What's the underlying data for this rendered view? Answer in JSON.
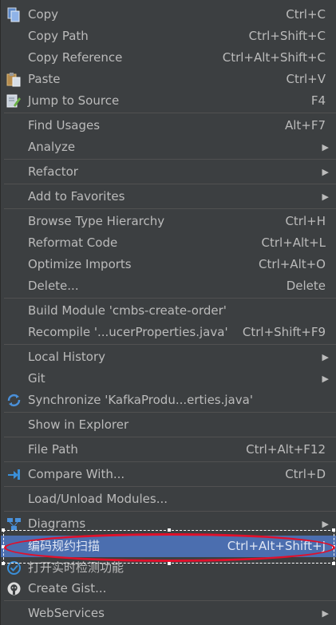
{
  "items": [
    {
      "label": "Copy",
      "shortcut": "Ctrl+C",
      "icon": "copy-icon"
    },
    {
      "label": "Copy Path",
      "shortcut": "Ctrl+Shift+C"
    },
    {
      "label": "Copy Reference",
      "shortcut": "Ctrl+Alt+Shift+C"
    },
    {
      "label": "Paste",
      "shortcut": "Ctrl+V",
      "icon": "paste-icon"
    },
    {
      "label": "Jump to Source",
      "shortcut": "F4",
      "icon": "edit-source-icon"
    },
    {
      "label": "Find Usages",
      "shortcut": "Alt+F7"
    },
    {
      "label": "Analyze",
      "submenu": true
    },
    {
      "label": "Refactor",
      "submenu": true
    },
    {
      "label": "Add to Favorites",
      "submenu": true
    },
    {
      "label": "Browse Type Hierarchy",
      "shortcut": "Ctrl+H"
    },
    {
      "label": "Reformat Code",
      "shortcut": "Ctrl+Alt+L"
    },
    {
      "label": "Optimize Imports",
      "shortcut": "Ctrl+Alt+O"
    },
    {
      "label": "Delete...",
      "shortcut": "Delete"
    },
    {
      "label": "Build Module 'cmbs-create-order'"
    },
    {
      "label": "Recompile '...ucerProperties.java'",
      "shortcut": "Ctrl+Shift+F9"
    },
    {
      "label": "Local History",
      "submenu": true
    },
    {
      "label": "Git",
      "submenu": true
    },
    {
      "label": "Synchronize 'KafkaProdu...erties.java'",
      "icon": "sync-icon"
    },
    {
      "label": "Show in Explorer"
    },
    {
      "label": "File Path",
      "shortcut": "Ctrl+Alt+F12"
    },
    {
      "label": "Compare With...",
      "shortcut": "Ctrl+D",
      "icon": "compare-icon"
    },
    {
      "label": "Load/Unload Modules..."
    },
    {
      "label": "Diagrams",
      "submenu": true,
      "icon": "diagram-icon"
    },
    {
      "label": "编码规约扫描",
      "shortcut": "Ctrl+Alt+Shift+J"
    },
    {
      "label": "打开实时检测功能",
      "icon": "realtime-check-icon"
    },
    {
      "label": "Create Gist...",
      "icon": "github-icon"
    },
    {
      "label": "WebServices",
      "submenu": true
    }
  ],
  "colors": {
    "background": "#3c3f41",
    "text": "#bbbbbb",
    "highlight": "#4b6eaf",
    "annotation": "#e0102b"
  }
}
